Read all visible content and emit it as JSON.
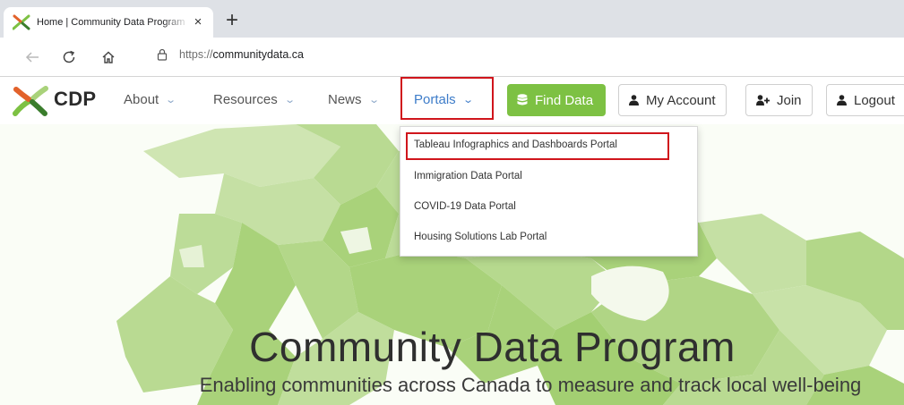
{
  "browser": {
    "tab_title": "Home | Community Data Program",
    "tab_close": "×",
    "new_tab": "+",
    "url_scheme": "https://",
    "url_host": "communitydata.ca"
  },
  "site": {
    "brand": "CDP",
    "nav": {
      "about": "About",
      "resources": "Resources",
      "news": "News",
      "portals": "Portals",
      "find_data": "Find Data",
      "my_account": "My Account",
      "join": "Join",
      "logout": "Logout"
    }
  },
  "dropdown": {
    "items": [
      "Tableau Infographics and Dashboards Portal",
      "Immigration Data Portal",
      "COVID-19 Data Portal",
      "Housing Solutions Lab Portal"
    ]
  },
  "hero": {
    "title": "Community Data Program",
    "subtitle": "Enabling communities across Canada to measure and track local well-being"
  },
  "colors": {
    "accent_green": "#7dc143",
    "link_blue": "#3d7cc9",
    "highlight_red": "#d0151c",
    "map_green": "#a9d27a"
  }
}
